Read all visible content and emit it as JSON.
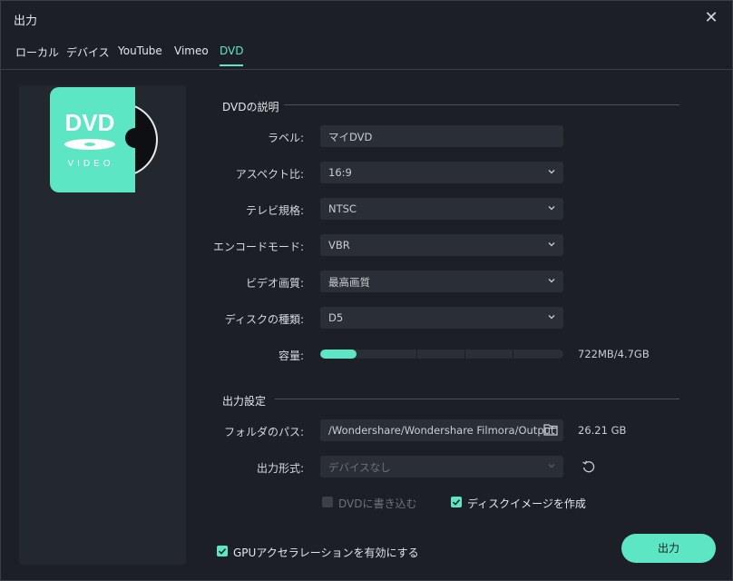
{
  "window": {
    "title": "出力"
  },
  "tabs": [
    {
      "label": "ローカル",
      "active": false
    },
    {
      "label": "デバイス",
      "active": false
    },
    {
      "label": "YouTube",
      "active": false
    },
    {
      "label": "Vimeo",
      "active": false
    },
    {
      "label": "DVD",
      "active": true
    }
  ],
  "art": {
    "logo_text": "DVD",
    "sub_text": "VIDEO"
  },
  "dvd_section": {
    "title": "DVDの説明",
    "label_label": "ラベル:",
    "label_value": "マイDVD",
    "aspect_label": "アスペクト比:",
    "aspect_value": "16:9",
    "tv_label": "テレビ規格:",
    "tv_value": "NTSC",
    "encode_label": "エンコードモード:",
    "encode_value": "VBR",
    "quality_label": "ビデオ画質:",
    "quality_value": "最高画質",
    "disc_label": "ディスクの種類:",
    "disc_value": "D5",
    "capacity_label": "容量:",
    "capacity_text": "722MB/4.7GB",
    "capacity_fraction": 0.15
  },
  "output_section": {
    "title": "出力設定",
    "folder_label": "フォルダのパス:",
    "folder_value": "/Wondershare/Wondershare Filmora/Output",
    "free_space": "26.21 GB",
    "format_label": "出力形式:",
    "format_value": "デバイスなし",
    "burn_label": "DVDに書き込む",
    "burn_checked": false,
    "iso_label": "ディスクイメージを作成",
    "iso_checked": true
  },
  "footer": {
    "gpu_label": "GPUアクセラレーションを有効にする",
    "gpu_checked": true,
    "export_label": "出力"
  },
  "colors": {
    "accent": "#5ce6c4",
    "background": "#1c2026",
    "field": "#2a2f37"
  }
}
